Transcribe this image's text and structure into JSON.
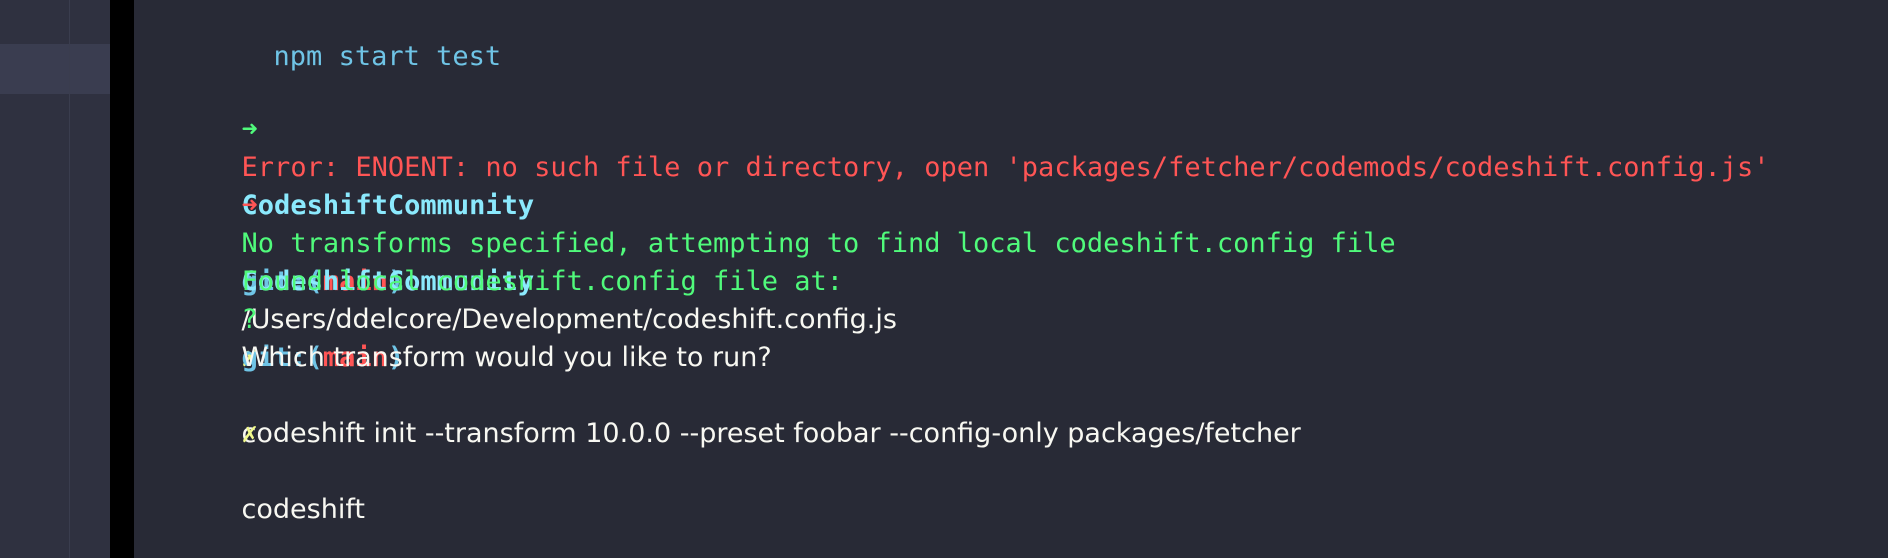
{
  "colors": {
    "background": "#282a36",
    "sidebar_bg": "#2f3140",
    "cyan": "#8be9fd",
    "green": "#50fa7b",
    "red": "#ff5555",
    "yellow": "#f1fa8c",
    "white": "#f8f8f2",
    "blue_text": "#6fc4e6"
  },
  "terminal": {
    "lines": [
      {
        "text": "npm start test"
      },
      {
        "text": ""
      },
      {
        "arrow": "➜",
        "dir": "CodeshiftCommunity",
        "git": "git:(",
        "branch": "main",
        "git_close": ")",
        "dirty": "✗",
        "command": "codeshift init --transform 10.0.0 --preset foobar --config-only packages/fetcher"
      },
      {
        "text": "Error: ENOENT: no such file or directory, open 'packages/fetcher/codemods/codeshift.config.js'"
      },
      {
        "arrow": "➜",
        "dir": "CodeshiftCommunity",
        "git": "git:(",
        "branch": "main",
        "git_close": ")",
        "dirty": "✗",
        "command": "codeshift"
      },
      {
        "text": "No transforms specified, attempting to find local codeshift.config file"
      },
      {
        "label": "Found local codeshift.config file at:",
        "path": "/Users/ddelcore/Development/codeshift.config.js"
      },
      {
        "qmark": "?",
        "question": "Which transform would you like to run?"
      }
    ]
  }
}
